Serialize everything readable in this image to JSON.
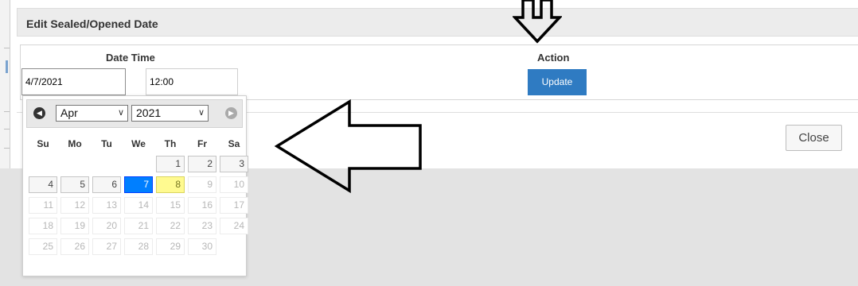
{
  "dialog": {
    "title": "Edit Sealed/Opened Date"
  },
  "datetime_panel": {
    "header_datetime": "Date Time",
    "header_action": "Action",
    "date_value": "4/7/2021",
    "time_value": "12:00",
    "update_label": "Update"
  },
  "footer": {
    "close_label": "Close"
  },
  "datepicker": {
    "prev_icon": "chevron-left-circle",
    "next_icon": "chevron-right-circle",
    "month": "Apr",
    "year": "2021",
    "weekdays": [
      "Su",
      "Mo",
      "Tu",
      "We",
      "Th",
      "Fr",
      "Sa"
    ],
    "days": [
      [
        null,
        null,
        null,
        null,
        "1",
        "2",
        "3"
      ],
      [
        "4",
        "5",
        "6",
        "7",
        "8",
        "9",
        "10"
      ],
      [
        "11",
        "12",
        "13",
        "14",
        "15",
        "16",
        "17"
      ],
      [
        "18",
        "19",
        "20",
        "21",
        "22",
        "23",
        "24"
      ],
      [
        "25",
        "26",
        "27",
        "28",
        "29",
        "30",
        null
      ]
    ],
    "selected_day": "7",
    "today_day": "8",
    "last_selectable_day": "8",
    "colors": {
      "selected": "#007fff",
      "today": "#fffa90",
      "update_button": "#2f7bc2"
    }
  }
}
